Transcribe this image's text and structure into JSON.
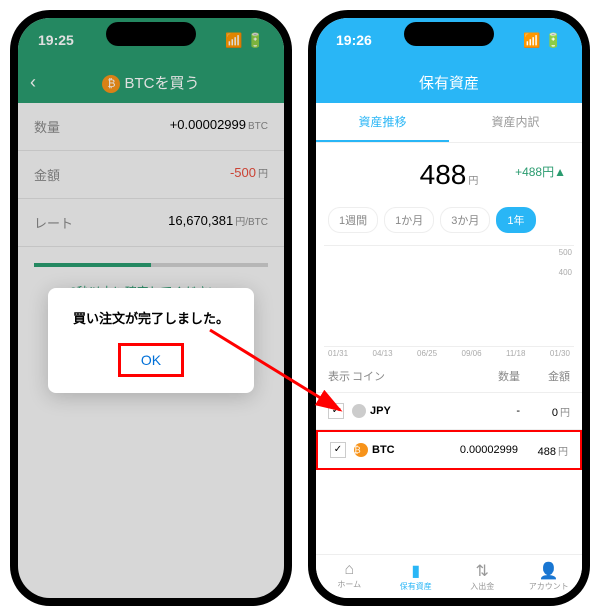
{
  "left": {
    "time": "19:25",
    "title": "BTCを買う",
    "qty_label": "数量",
    "qty_value": "+0.00002999",
    "qty_unit": "BTC",
    "amt_label": "金額",
    "amt_value": "-500",
    "amt_unit": "円",
    "rate_label": "レート",
    "rate_value": "16,670,381",
    "rate_unit": "円/BTC",
    "confirm_text": "3秒以内に確定してください。",
    "modal_title": "買い注文が完了しました。",
    "modal_ok": "OK"
  },
  "right": {
    "time": "19:26",
    "title": "保有資産",
    "tab1": "資産推移",
    "tab2": "資産内訳",
    "balance": "488",
    "balance_unit": "円",
    "change": "+488円▲",
    "periods": {
      "p1": "1週間",
      "p2": "1か月",
      "p3": "3か月",
      "p4": "1年"
    },
    "y_500": "500",
    "y_400": "400",
    "dates": {
      "d1": "01/31",
      "d2": "04/13",
      "d3": "06/25",
      "d4": "09/06",
      "d5": "11/18",
      "d6": "01/30"
    },
    "th_show": "表示",
    "th_coin": "コイン",
    "th_qty": "数量",
    "th_amt": "金額",
    "jpy_name": "JPY",
    "jpy_qty": "-",
    "jpy_amt": "0",
    "jpy_unit": "円",
    "btc_name": "BTC",
    "btc_qty": "0.00002999",
    "btc_amt": "488",
    "btc_unit": "円",
    "nav": {
      "home": "ホーム",
      "assets": "保有資産",
      "io": "入出金",
      "account": "アカウント"
    }
  }
}
